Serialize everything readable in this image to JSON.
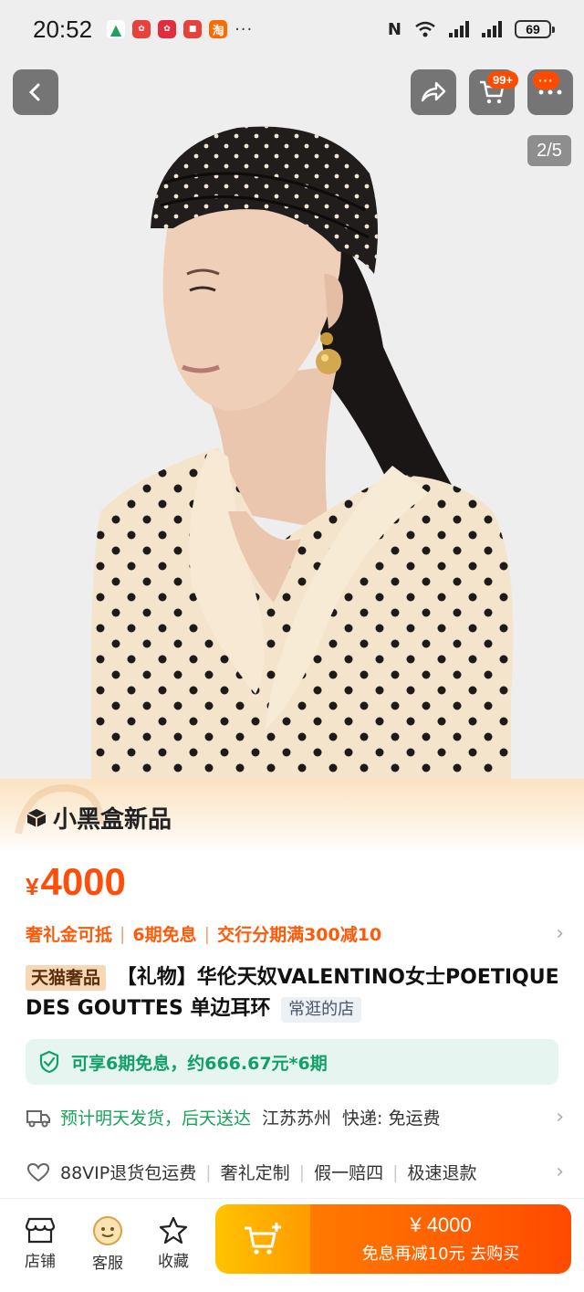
{
  "status_bar": {
    "time": "20:52",
    "battery": "69",
    "more": "···",
    "notification_icons": [
      "mountain-app-icon",
      "huawei-icon",
      "huawei-icon",
      "red-app-icon",
      "taobao-icon"
    ],
    "taobao_glyph": "淘",
    "nfc_glyph": "N"
  },
  "top_bar": {
    "cart_badge": "99+",
    "more_badge": "···",
    "image_counter": "2/5"
  },
  "new_strip": {
    "label": "小黑盒新品"
  },
  "price": {
    "currency": "¥",
    "amount": "4000",
    "color": "#ff4d0a"
  },
  "promos": [
    "奢礼金可抵",
    "6期免息",
    "交行分期满300减10"
  ],
  "title": {
    "tag": "天猫奢品",
    "text": "【礼物】华伦天奴VALENTINO女士POETIQUE DES GOUTTES 单边耳环",
    "shop_tag": "常逛的店"
  },
  "installment": {
    "text": "可享6期免息，约666.67元*6期"
  },
  "delivery": {
    "estimate": "预计明天发货，后天送达",
    "location": "江苏苏州",
    "courier": "快递: 免运费"
  },
  "services": [
    "88VIP退货包运费",
    "奢礼定制",
    "假一赔四",
    "极速退款"
  ],
  "bottom_bar": {
    "store": "店铺",
    "customer_service": "客服",
    "favorite": "收藏",
    "buy_price": "¥ 4000",
    "buy_label": "免息再减10元  去购买"
  },
  "colors": {
    "accent": "#ff4a00",
    "green": "#12a06a",
    "cart_gradient_start": "#ffc300"
  }
}
